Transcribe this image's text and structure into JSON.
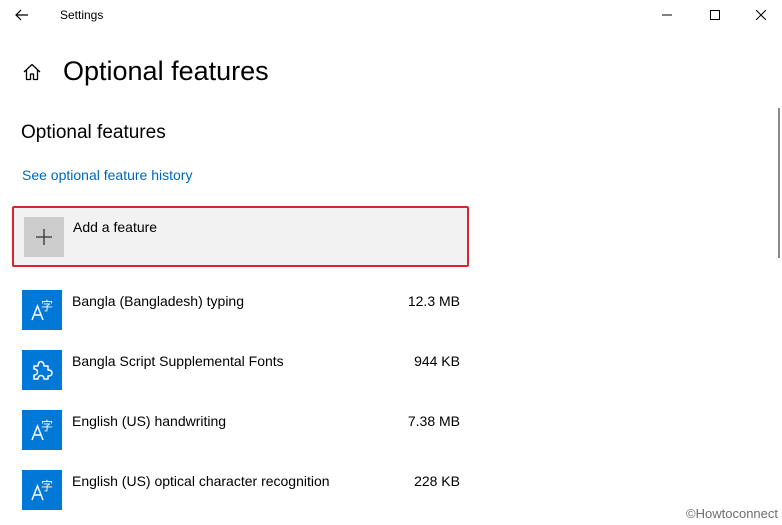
{
  "window": {
    "title": "Settings",
    "controls": {
      "minimize": "minimize",
      "maximize": "maximize",
      "close": "close"
    }
  },
  "header": {
    "title": "Optional features",
    "home_icon": "home-icon",
    "back_icon": "back-arrow-icon"
  },
  "section": {
    "title": "Optional features",
    "history_link": "See optional feature history"
  },
  "add_feature": {
    "label": "Add a feature",
    "icon": "plus-icon"
  },
  "features": [
    {
      "name": "Bangla (Bangladesh) typing",
      "size": "12.3 MB",
      "icon": "language-icon"
    },
    {
      "name": "Bangla Script Supplemental Fonts",
      "size": "944 KB",
      "icon": "puzzle-icon"
    },
    {
      "name": "English (US) handwriting",
      "size": "7.38 MB",
      "icon": "language-icon"
    },
    {
      "name": "English (US) optical character recognition",
      "size": "228 KB",
      "icon": "language-icon"
    }
  ],
  "watermark": "©Howtoconnect",
  "colors": {
    "accent": "#0078d7",
    "link": "#0067b8",
    "highlight_border": "#d9232d",
    "add_bg": "#f2f2f2",
    "add_tile": "#cccccc"
  }
}
